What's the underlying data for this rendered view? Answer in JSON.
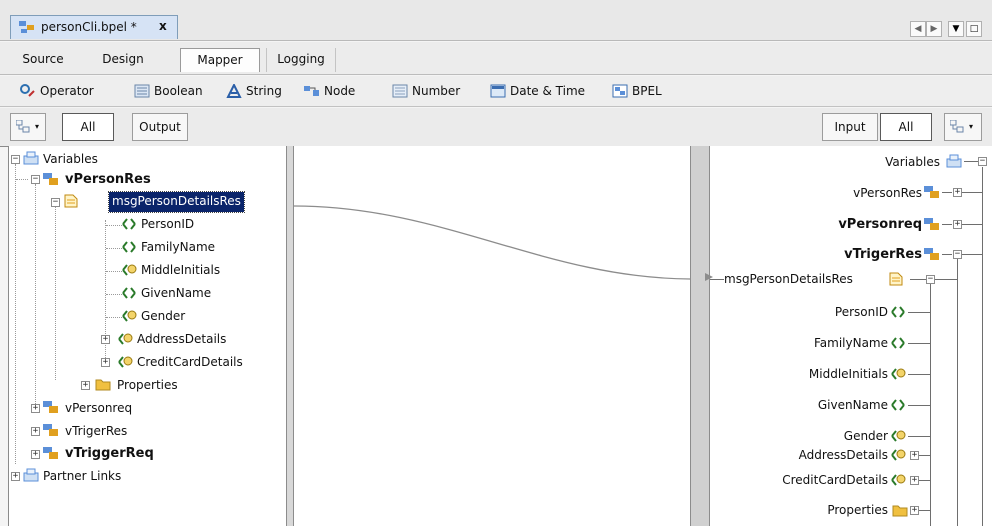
{
  "file_tab": {
    "title": "personCli.bpel *",
    "close": "x"
  },
  "view_tabs": [
    {
      "label": "Source"
    },
    {
      "label": "Design"
    },
    {
      "label": "Mapper",
      "selected": true
    },
    {
      "label": "Logging"
    }
  ],
  "palette": [
    {
      "label": "Operator",
      "icon": "operator-icon"
    },
    {
      "label": "Boolean",
      "icon": "boolean-icon"
    },
    {
      "label": "String",
      "icon": "string-icon"
    },
    {
      "label": "Node",
      "icon": "node-icon"
    },
    {
      "label": "Number",
      "icon": "number-icon"
    },
    {
      "label": "Date & Time",
      "icon": "date-time-icon"
    },
    {
      "label": "BPEL",
      "icon": "bpel-icon"
    }
  ],
  "left_toggles": {
    "all": "All",
    "output": "Output"
  },
  "right_toggles": {
    "input": "Input",
    "all": "All"
  },
  "left_tree": {
    "root": "Variables",
    "vPersonRes": "vPersonRes",
    "msg": "msgPersonDetailsRes",
    "fields": [
      "PersonID",
      "FamilyName",
      "MiddleInitials",
      "GivenName",
      "Gender",
      "AddressDetails",
      "CreditCardDetails"
    ],
    "properties": "Properties",
    "others": [
      "vPersonreq",
      "vTrigerRes",
      "vTriggerReq"
    ],
    "partner_links": "Partner Links"
  },
  "right_tree": {
    "root": "Variables",
    "vars": [
      "vPersonRes",
      "vPersonreq",
      "vTrigerRes"
    ],
    "msg": "msgPersonDetailsRes",
    "fields": [
      "PersonID",
      "FamilyName",
      "MiddleInitials",
      "GivenName",
      "Gender",
      "AddressDetails",
      "CreditCardDetails"
    ],
    "properties": "Properties"
  },
  "colors": {
    "selection": "#0a246a",
    "variable_icon": "#e0a020",
    "folder": "#f0c040",
    "element_icon": "#2a7a2a"
  }
}
